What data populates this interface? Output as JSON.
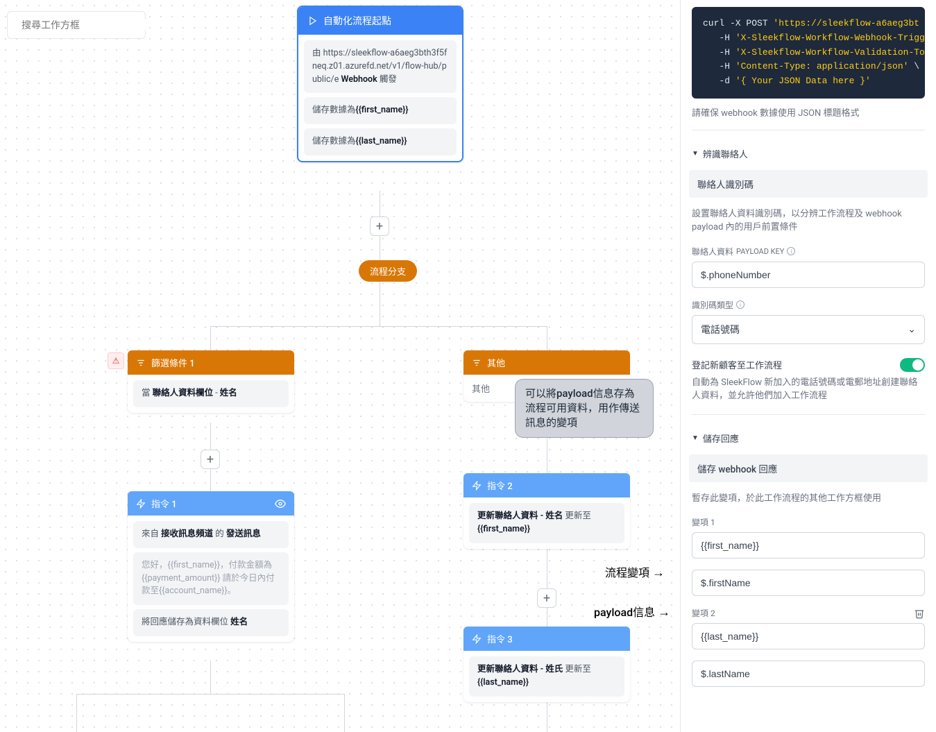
{
  "search": {
    "placeholder": "搜尋工作方框"
  },
  "start_node": {
    "title": "自動化流程起點",
    "block1_prefix": "由 ",
    "block1_url": "https://sleekflow-a6aeg3bth3f5fneq.z01.azurefd.net/v1/flow-hub/public/e",
    "block1_webhook": "Webhook",
    "block1_trigger": "觸發",
    "block2_prefix": "儲存數據為",
    "block2_var": "{{first_name}}",
    "block3_prefix": "儲存數據為",
    "block3_var": "{{last_name}}"
  },
  "branch_label": "流程分支",
  "cond1": {
    "title": "篩選條件 1",
    "body_prefix": "當 ",
    "body_bold": "聯絡人資料欄位",
    "body_dash": " - ",
    "body_field": "姓名"
  },
  "other_node": {
    "title": "其他",
    "body": "其他"
  },
  "tooltip": "可以將payload信息存為流程可用資料，用作傳送訊息的變項",
  "action1": {
    "title": "指令 1",
    "row1_prefix": "來自 ",
    "row1_bold1": "接收訊息頻道",
    "row1_mid": " 的 ",
    "row1_bold2": "發送訊息",
    "row2": "您好，{{first_name}}，付款金額為{{payment_amount}} 請於今日內付款至{{account_name}}。",
    "row3_prefix": "將回應儲存為資料欄位 ",
    "row3_bold": "姓名"
  },
  "action2": {
    "title": "指令 2",
    "body_bold": "更新聯絡人資料 - 姓名",
    "body_mid": " 更新至",
    "body_var": "{{first_name}}"
  },
  "action3": {
    "title": "指令 3",
    "body_bold": "更新聯絡人資料 - 姓氏",
    "body_mid": " 更新至",
    "body_var": "{{last_name}}"
  },
  "annot1": "流程變項",
  "annot2": "payload信息",
  "sidebar": {
    "code_l1a": "curl -X POST ",
    "code_l1b": "'https://sleekflow-a6aeg3bt",
    "code_l2a": "   -H ",
    "code_l2b": "'X-Sleekflow-Workflow-Webhook-Trigg",
    "code_l3a": "   -H ",
    "code_l3b": "'X-Sleekflow-Workflow-Validation-To",
    "code_l4a": "   -H ",
    "code_l4b": "'Content-Type: application/json'",
    "code_l4c": " \\",
    "code_l5a": "   -d ",
    "code_l5b": "'{ Your JSON Data here }'",
    "code_helper": "請確保 webhook 數據使用 JSON 標題格式",
    "sec1_title": "辨識聯絡人",
    "panel1_title": "聯絡人識別碼",
    "panel1_desc": "設置聯絡人資料識別碼，以分辨工作流程及 webhook payload 內的用戶前置條件",
    "payload_key_label": "聯絡人資料 ",
    "payload_key_label2": "PAYLOAD KEY",
    "payload_key_value": "$.phoneNumber",
    "id_type_label": "識別碼類型",
    "id_type_value": "電話號碼",
    "toggle_label": "登記新顧客至工作流程",
    "toggle_desc": "自動為 SleekFlow 新加入的電話號碼或電郵地址創建聯絡人資料，並允許他們加入工作流程",
    "sec2_title": "儲存回應",
    "panel2_title": "儲存 webhook 回應",
    "panel2_desc": "暫存此變項，於此工作流程的其他工作方框使用",
    "var1_label": "變項 1",
    "var1_name": "{{first_name}}",
    "var1_path": "$.firstName",
    "var2_label": "變項 2",
    "var2_name": "{{last_name}}",
    "var2_path": "$.lastName"
  }
}
